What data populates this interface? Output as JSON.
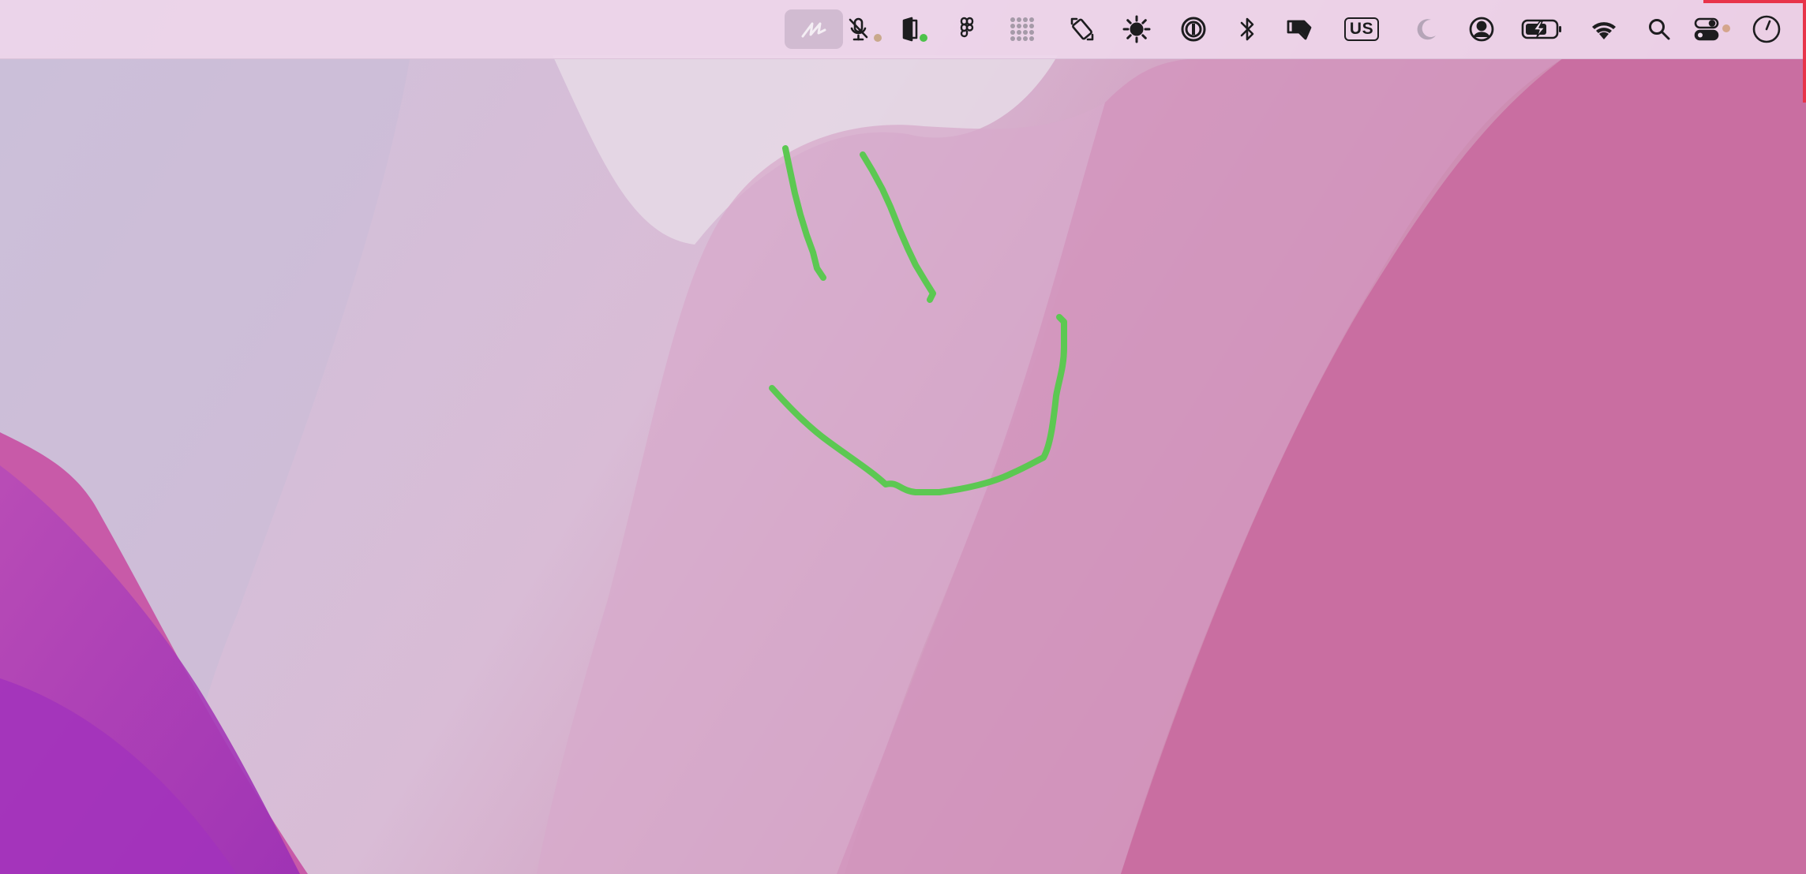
{
  "colors": {
    "stroke": "#5cc852",
    "mic_dot": "#c9a98c",
    "camera_dot": "#4cc24a",
    "control_dot": "#d4a58c",
    "accent_red": "#e8344a"
  },
  "menubar": {
    "items": [
      {
        "name": "drawing-tool-icon",
        "active": true
      },
      {
        "name": "microphone-icon",
        "status_dot": "mic_dot"
      },
      {
        "name": "camera-door-icon",
        "status_dot": "camera_dot"
      },
      {
        "name": "figma-icon"
      },
      {
        "name": "app-grid-icon"
      },
      {
        "name": "screen-rotate-icon"
      },
      {
        "name": "brightness-icon"
      },
      {
        "name": "password-manager-icon"
      },
      {
        "name": "bluetooth-icon"
      },
      {
        "name": "tag-icon"
      },
      {
        "name": "keyboard-layout-icon",
        "label": "US"
      },
      {
        "name": "moon-icon"
      },
      {
        "name": "user-account-icon"
      },
      {
        "name": "battery-charging-icon"
      },
      {
        "name": "wifi-icon"
      },
      {
        "name": "search-icon"
      },
      {
        "name": "control-center-icon",
        "status_dot": "control_dot"
      },
      {
        "name": "clock-icon"
      }
    ]
  }
}
